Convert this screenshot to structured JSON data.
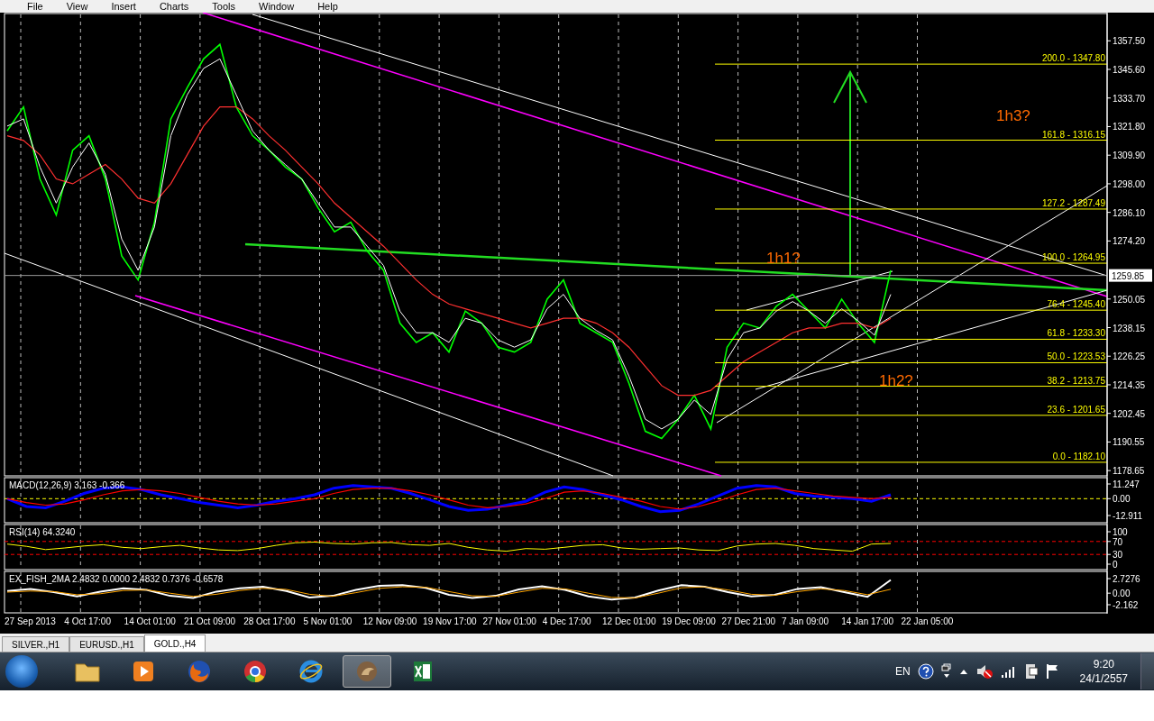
{
  "menu": [
    "File",
    "View",
    "Insert",
    "Charts",
    "Tools",
    "Window",
    "Help"
  ],
  "panels": [
    {
      "kind": "price",
      "last_price": "1259.85",
      "axis_labels": [
        "1357.50",
        "1345.60",
        "1333.70",
        "1321.80",
        "1309.90",
        "1298.00",
        "1286.10",
        "1274.20",
        "1250.05",
        "1238.15",
        "1226.25",
        "1214.35",
        "1202.45",
        "1190.55",
        "1178.65"
      ],
      "fib_levels": [
        "200.0 - 1347.80",
        "161.8 - 1316.15",
        "127.2 - 1287.49",
        "100.0 - 1264.95",
        "76.4 - 1245.40",
        "61.8 - 1233.30",
        "50.0 - 1223.53",
        "38.2 - 1213.75",
        "23.6 - 1201.65",
        "0.0 - 1182.10"
      ],
      "notes": [
        "1h3?",
        "1h1?",
        "1h2?"
      ]
    },
    {
      "kind": "macd",
      "label": "MACD(12,26,9) 3.163 -0.366",
      "axis_labels": [
        "11.247",
        "0.00",
        "-12.911"
      ]
    },
    {
      "kind": "rsi",
      "label": "RSI(14) 64.3240",
      "axis_labels": [
        "100",
        "70",
        "30",
        "0"
      ]
    },
    {
      "kind": "fisher",
      "label": "EX_FISH_2MA 2.4832 0.0000 2.4832 0.7376 -0.6578",
      "axis_labels": [
        "2.7276",
        "0.00",
        "-2.162"
      ]
    }
  ],
  "time_axis": [
    "27 Sep 2013",
    "4 Oct 17:00",
    "14 Oct 01:00",
    "21 Oct 09:00",
    "28 Oct 17:00",
    "5 Nov 01:00",
    "12 Nov 09:00",
    "19 Nov 17:00",
    "27 Nov 01:00",
    "4 Dec 17:00",
    "12 Dec 01:00",
    "19 Dec 09:00",
    "27 Dec 21:00",
    "7 Jan 09:00",
    "14 Jan 17:00",
    "22 Jan 05:00"
  ],
  "tabs": [
    {
      "label": "SILVER.,H1",
      "selected": false
    },
    {
      "label": "EURUSD.,H1",
      "selected": false
    },
    {
      "label": "GOLD.,H4",
      "selected": true
    }
  ],
  "taskbar": {
    "apps": [
      {
        "kind": "folder",
        "selected": false
      },
      {
        "kind": "media",
        "selected": false
      },
      {
        "kind": "firefox",
        "selected": false
      },
      {
        "kind": "chrome",
        "selected": false
      },
      {
        "kind": "ie",
        "selected": false
      },
      {
        "kind": "chart",
        "selected": true
      },
      {
        "kind": "spreadsheet",
        "selected": false
      }
    ],
    "language": "EN",
    "time": "9:20",
    "date": "24/1/2557"
  }
}
